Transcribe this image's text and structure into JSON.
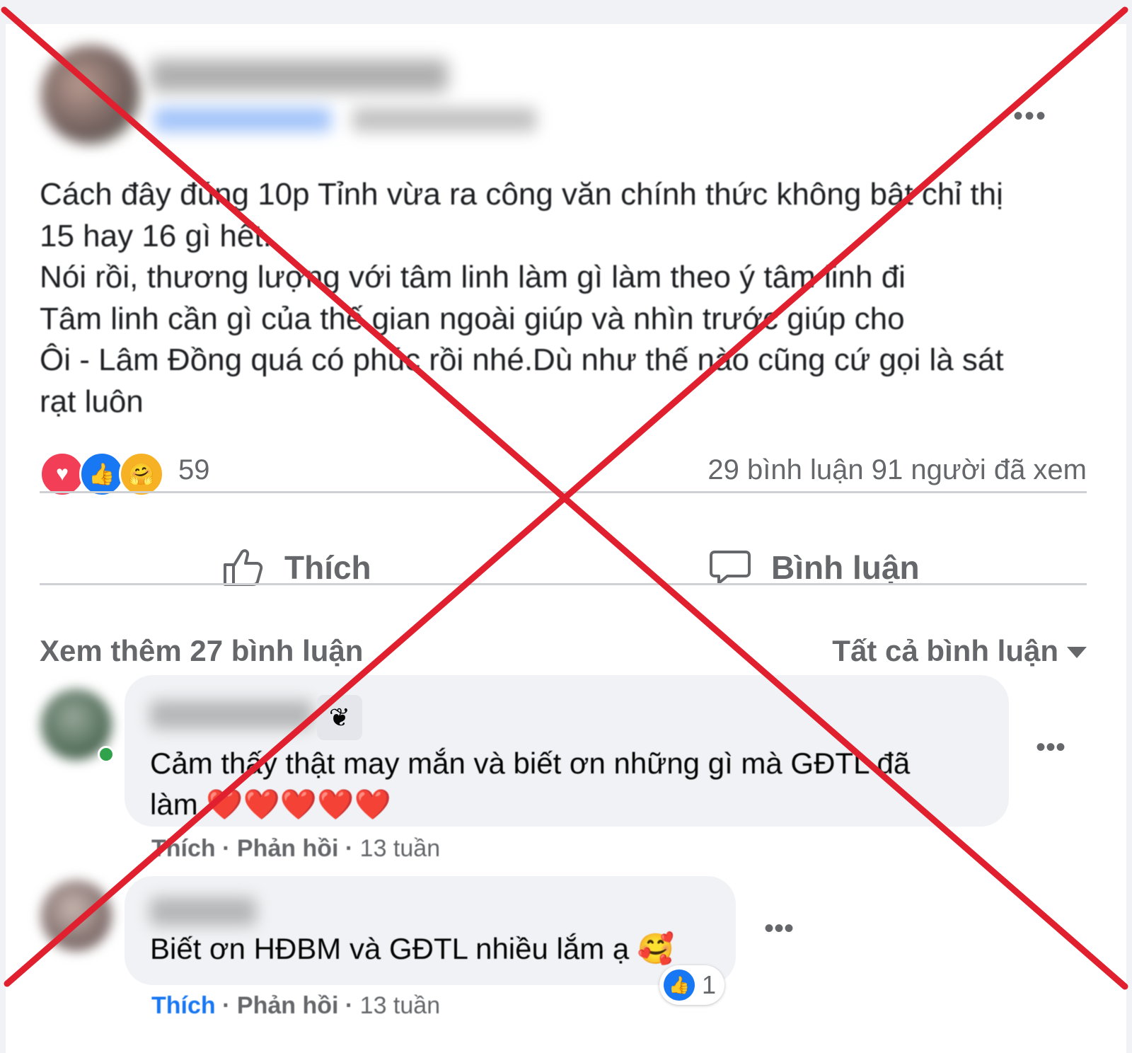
{
  "post": {
    "more": "•••",
    "text": "Cách đây đúng 10p Tỉnh vừa ra công văn chính thức không bật chỉ thị\n15 hay 16 gì hết.\nNói rồi, thương lượng với tâm linh làm gì làm theo ý tâm linh đi\nTâm linh cần gì của thế gian ngoài giúp và nhìn trước giúp cho\nÔi - Lâm Đồng quá có phúc rồi nhé.Dù như thế nào cũng cứ gọi là sát\nrạt luôn",
    "reaction_count": "59",
    "comment_stats": "29 bình luận  91 người đã xem",
    "like_label": "Thích",
    "comment_label": "Bình luận"
  },
  "comments_bar": {
    "view_more": "Xem thêm 27 bình luận",
    "filter": "Tất cả bình luận"
  },
  "comments": [
    {
      "text": "Cảm thấy thật may mắn và biết ơn những gì mà GĐTL đã\nlàm ❤️❤️❤️❤️❤️",
      "like": "Thích",
      "reply": "Phản hồi",
      "time": "13 tuần",
      "more": "•••"
    },
    {
      "text": "Biết ơn HĐBM và GĐTL nhiều lắm ạ 🥰",
      "like": "Thích",
      "reply": "Phản hồi",
      "time": "13 tuần",
      "more": "•••",
      "like_count": "1"
    }
  ],
  "colors": {
    "overlay_x": "#e0202e",
    "like_blue": "#1877f2",
    "meta_gray": "#65676b"
  },
  "icons": [
    "love-reaction-icon",
    "like-reaction-icon",
    "care-reaction-icon",
    "thumbs-up-icon",
    "comment-bubble-icon",
    "caret-down-icon",
    "sprout-badge-icon"
  ]
}
